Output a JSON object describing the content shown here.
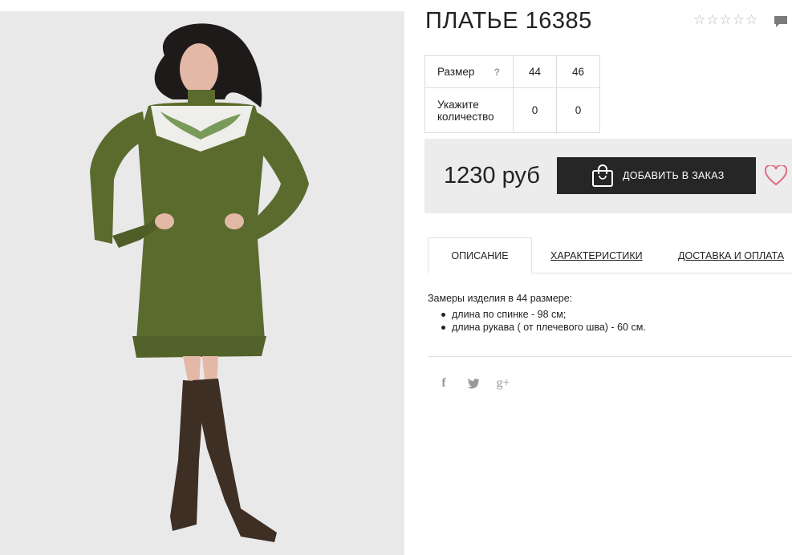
{
  "product": {
    "title": "ПЛАТЬЕ 16385",
    "rating": {
      "filled": 0,
      "max": 5
    },
    "image_alt": "dress photo"
  },
  "sizes": {
    "size_label": "Размер",
    "help": "?",
    "qty_label_line1": "Укажите",
    "qty_label_line2": "количество",
    "options": [
      {
        "size": "44",
        "qty": "0"
      },
      {
        "size": "46",
        "qty": "0"
      }
    ]
  },
  "buy": {
    "price": "1230 руб",
    "add_label": "ДОБАВИТЬ В ЗАКАЗ"
  },
  "tabs": [
    {
      "label": "ОПИСАНИЕ",
      "active": true
    },
    {
      "label": "ХАРАКТЕРИСТИКИ",
      "active": false
    },
    {
      "label": "ДОСТАВКА И ОПЛАТА",
      "active": false
    }
  ],
  "description": {
    "intro": "Замеры изделия в 44 размере:",
    "items": [
      "длина по спинке - 98 см;",
      "длина рукава ( от плечевого шва) - 60 см."
    ]
  },
  "social": {
    "facebook": "f",
    "twitter": "t",
    "googleplus": "g+"
  },
  "colors": {
    "button": "#262626",
    "heart": "#e0738a",
    "buybox": "#ececec",
    "dress": "#5b6b2e"
  }
}
